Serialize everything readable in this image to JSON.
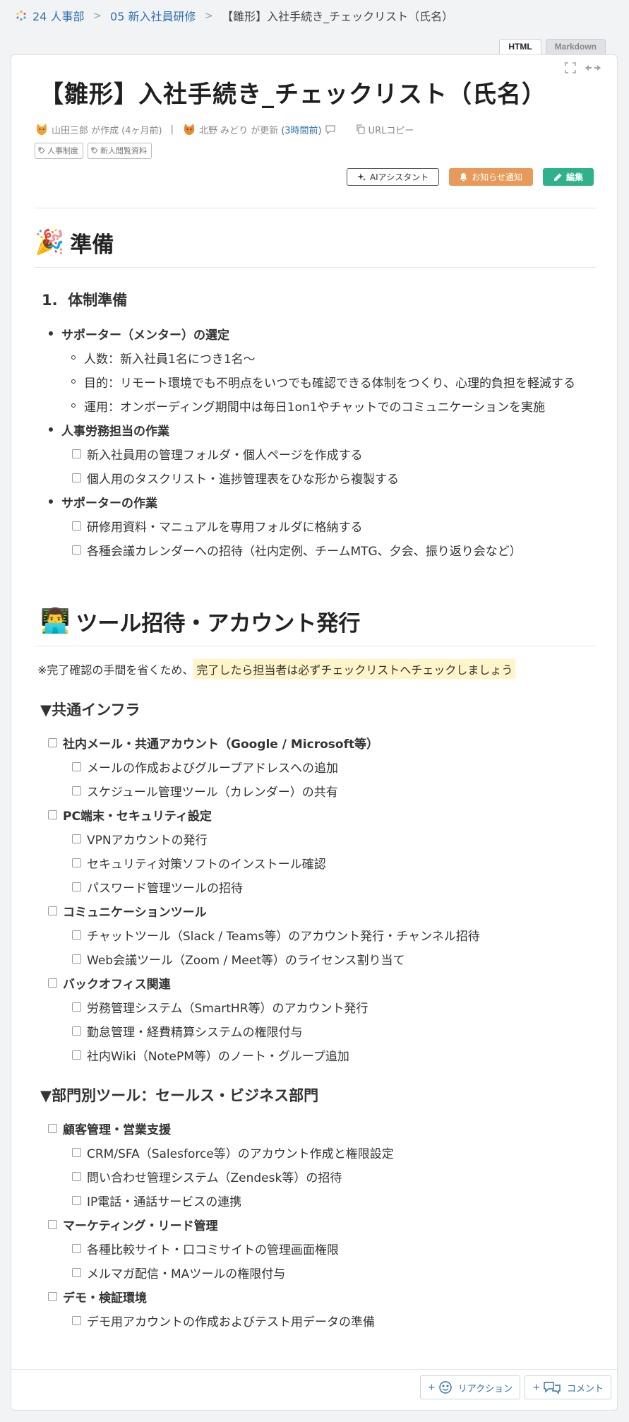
{
  "breadcrumb": {
    "items": [
      "24 人事部",
      "05 新入社員研修"
    ],
    "separator": ">",
    "current": "【雛形】入社手続き_チェックリスト（氏名）"
  },
  "tabs": {
    "html": "HTML",
    "markdown": "Markdown"
  },
  "doc": {
    "title": "【雛形】入社手続き_チェックリスト（氏名）",
    "author": "山田三郎 が作成",
    "author_time": "(4ヶ月前)",
    "separator": "|",
    "updater": "北野 みどり が更新",
    "updated_time": "(3時間前)",
    "url_copy": "URLコピー",
    "tags": [
      "人事制度",
      "新人閲覧資料"
    ]
  },
  "actions": {
    "ai": "AIアシスタント",
    "notify": "お知らせ通知",
    "edit": "編集"
  },
  "section1": {
    "emoji": "🎉",
    "title": "準備",
    "sub_title": "1.  体制準備",
    "groups": [
      {
        "label": "サポーター（メンター）の選定",
        "items": [
          "人数：新入社員1名につき1名〜",
          "目的：リモート環境でも不明点をいつでも確認できる体制をつくり、心理的負担を軽減する",
          "運用：オンボーディング期間中は毎日1on1やチャットでのコミュニケーションを実施"
        ]
      },
      {
        "label": "人事労務担当の作業",
        "items": [
          "新入社員用の管理フォルダ・個人ページを作成する",
          "個人用のタスクリスト・進捗管理表をひな形から複製する"
        ]
      },
      {
        "label": "サポーターの作業",
        "items": [
          "研修用資料・マニュアルを専用フォルダに格納する",
          "各種会議カレンダーへの招待（社内定例、チームMTG、夕会、振り返り会など）"
        ]
      }
    ]
  },
  "section2": {
    "emoji": "👨‍💻",
    "title": "ツール招待・アカウント発行",
    "note_prefix": "※完了確認の手間を省くため、",
    "note_highlight": "完了したら担当者は必ずチェックリストへチェックしましょう",
    "common_title": "▼共通インフラ",
    "common": [
      {
        "label": "社内メール・共通アカウント（Google / Microsoft等）",
        "items": [
          "メールの作成およびグループアドレスへの追加",
          "スケジュール管理ツール（カレンダー）の共有"
        ]
      },
      {
        "label": "PC端末・セキュリティ設定",
        "items": [
          "VPNアカウントの発行",
          "セキュリティ対策ソフトのインストール確認",
          "パスワード管理ツールの招待"
        ]
      },
      {
        "label": "コミュニケーションツール",
        "items": [
          "チャットツール（Slack / Teams等）のアカウント発行・チャンネル招待",
          "Web会議ツール（Zoom / Meet等）のライセンス割り当て"
        ]
      },
      {
        "label": "バックオフィス関連",
        "items": [
          "労務管理システム（SmartHR等）のアカウント発行",
          "勤怠管理・経費精算システムの権限付与",
          "社内Wiki（NotePM等）のノート・グループ追加"
        ]
      }
    ],
    "dept_title": "▼部門別ツール：セールス・ビジネス部門",
    "dept": [
      {
        "label": "顧客管理・営業支援",
        "items": [
          "CRM/SFA（Salesforce等）のアカウント作成と権限設定",
          "問い合わせ管理システム（Zendesk等）の招待",
          "IP電話・通話サービスの連携"
        ]
      },
      {
        "label": "マーケティング・リード管理",
        "items": [
          "各種比較サイト・口コミサイトの管理画面権限",
          "メルマガ配信・MAツールの権限付与"
        ]
      },
      {
        "label": "デモ・検証環境",
        "items": [
          "デモ用アカウントの作成およびテスト用データの準備"
        ]
      }
    ]
  },
  "footer": {
    "reaction": "リアクション",
    "comment": "コメント",
    "plus": "+"
  }
}
